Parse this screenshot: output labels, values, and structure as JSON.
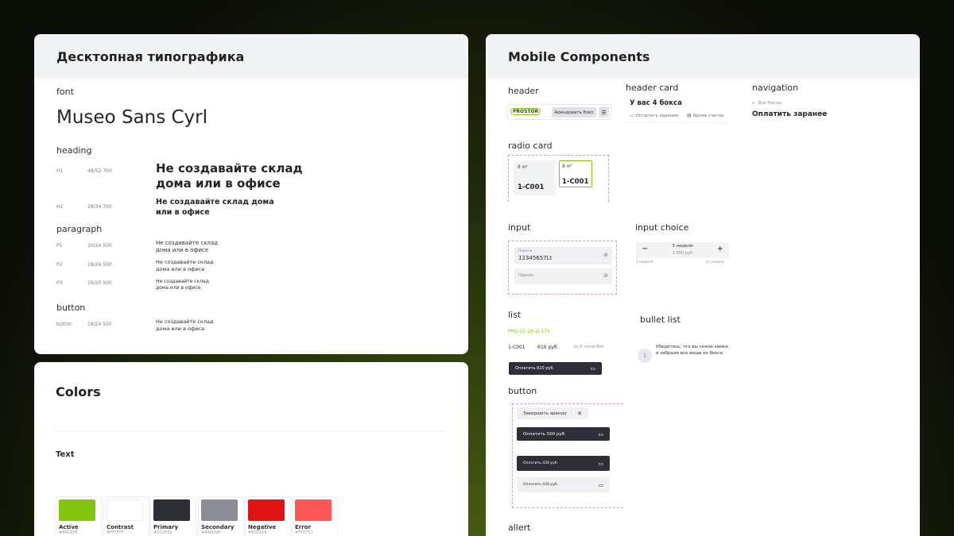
{
  "desktop": {
    "title": "Десктопная типографика",
    "font_label": "font",
    "font_name": "Museo Sans Cyrl",
    "heading_label": "heading",
    "h1": {
      "tag": "H1",
      "size": "48/52 700",
      "text1": "Не создавайте склад",
      "text2": "дома или в офисе"
    },
    "h2": {
      "tag": "H2",
      "size": "28/34 700",
      "text1": "Не создавайте склад дома",
      "text2": "или в офисе"
    },
    "paragraph_label": "paragraph",
    "p1": {
      "tag": "P1",
      "size": "20/24 500",
      "text1": "Не создавайте склад",
      "text2": "дома или в офисе"
    },
    "p2": {
      "tag": "P2",
      "size": "18/24 500",
      "text1": "Не создавайте склад",
      "text2": "дома или в офисе"
    },
    "p3": {
      "tag": "P3",
      "size": "16/20 500",
      "text1": "Не создавайте склад",
      "text2": "дома или в офисе"
    },
    "button_label": "button",
    "btn": {
      "tag": "button",
      "size": "18/24 500",
      "text1": "Не создавайте склад",
      "text2": "дома или в офисе"
    }
  },
  "colors": {
    "title": "Colors",
    "text_label": "Text",
    "swatches": [
      {
        "name": "Active",
        "sub": "#8AC80E",
        "color": "#84c60e"
      },
      {
        "name": "Contrast",
        "sub": "#FFFFFF",
        "color": "#ffffff"
      },
      {
        "name": "Primary",
        "sub": "#2C2F35",
        "color": "#2c2f35"
      },
      {
        "name": "Secondary",
        "sub": "#8A8D96",
        "color": "#8a8d96"
      },
      {
        "name": "Negative",
        "sub": "#E01414",
        "color": "#e01414"
      },
      {
        "name": "Error",
        "sub": "#FF5757",
        "color": "#ff5757"
      }
    ]
  },
  "mobile": {
    "title": "Mobile Components",
    "header_label": "header",
    "header": {
      "logo": "PROSTOR",
      "rent_button": "Арендовать бокс"
    },
    "header_card_label": "header card",
    "header_card": {
      "title": "У вас 4 бокса",
      "action1": "Оплатить заранее",
      "action2": "Архив счетов"
    },
    "navigation_label": "navigation",
    "navigation": {
      "back": "Все боксы",
      "title": "Оплатить заранее"
    },
    "radio_card_label": "radio card",
    "radio_cards": [
      {
        "size": "8 м²",
        "code": "1-C001"
      },
      {
        "size": "8 м²",
        "code": "1-C001"
      }
    ],
    "input_label": "input",
    "inputs": [
      {
        "label": "Пароль",
        "value": "12345657Lt"
      },
      {
        "label": "Пароль",
        "value": ""
      }
    ],
    "input_choice_label": "input choice",
    "input_choice": {
      "minus": "−",
      "value": "3 недели",
      "price": "1 560 руб",
      "plus": "+",
      "min": "1 неделя",
      "max": "12 недель"
    },
    "list_label": "list",
    "list": {
      "code": "PRO-S1-26-G-175",
      "box": "1-C001",
      "price": "610 руб.",
      "note": "от 5 суток/бит",
      "pay": "Оплатить 610 руб."
    },
    "bullet_label": "bullet list",
    "bullet": {
      "num": "1",
      "text1": "Убедитесь, что вы сняли замки",
      "text2": "и забрали все вещи из бокса"
    },
    "button_label": "button",
    "buttons": [
      {
        "text": "Завершить аренду"
      },
      {
        "text": "Оплатить 500 руб."
      },
      {
        "text": "Оплатить 430 руб."
      },
      {
        "text": "Оплатить 430 руб."
      }
    ],
    "allert_label": "allert"
  }
}
